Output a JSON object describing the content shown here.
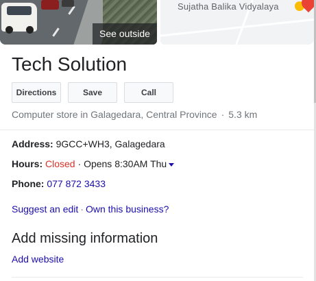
{
  "hero": {
    "see_outside_label": "See outside",
    "map_place_label": "Sujatha Balika Vidyalaya"
  },
  "business": {
    "name": "Tech Solution",
    "category": "Computer store in Galagedara, Central Province",
    "distance": "5.3 km"
  },
  "actions": {
    "directions": "Directions",
    "save": "Save",
    "call": "Call"
  },
  "details": {
    "address_label": "Address:",
    "address_value": "9GCC+WH3, Galagedara",
    "hours_label": "Hours:",
    "hours_status": "Closed",
    "hours_next": "Opens 8:30AM Thu",
    "phone_label": "Phone:",
    "phone_value": "077 872 3433"
  },
  "links": {
    "suggest_edit": "Suggest an edit",
    "own_business": "Own this business?"
  },
  "missing": {
    "title": "Add missing information",
    "add_website": "Add website"
  },
  "colors": {
    "link": "#1a0dab",
    "closed": "#d93025",
    "muted": "#70757a"
  }
}
